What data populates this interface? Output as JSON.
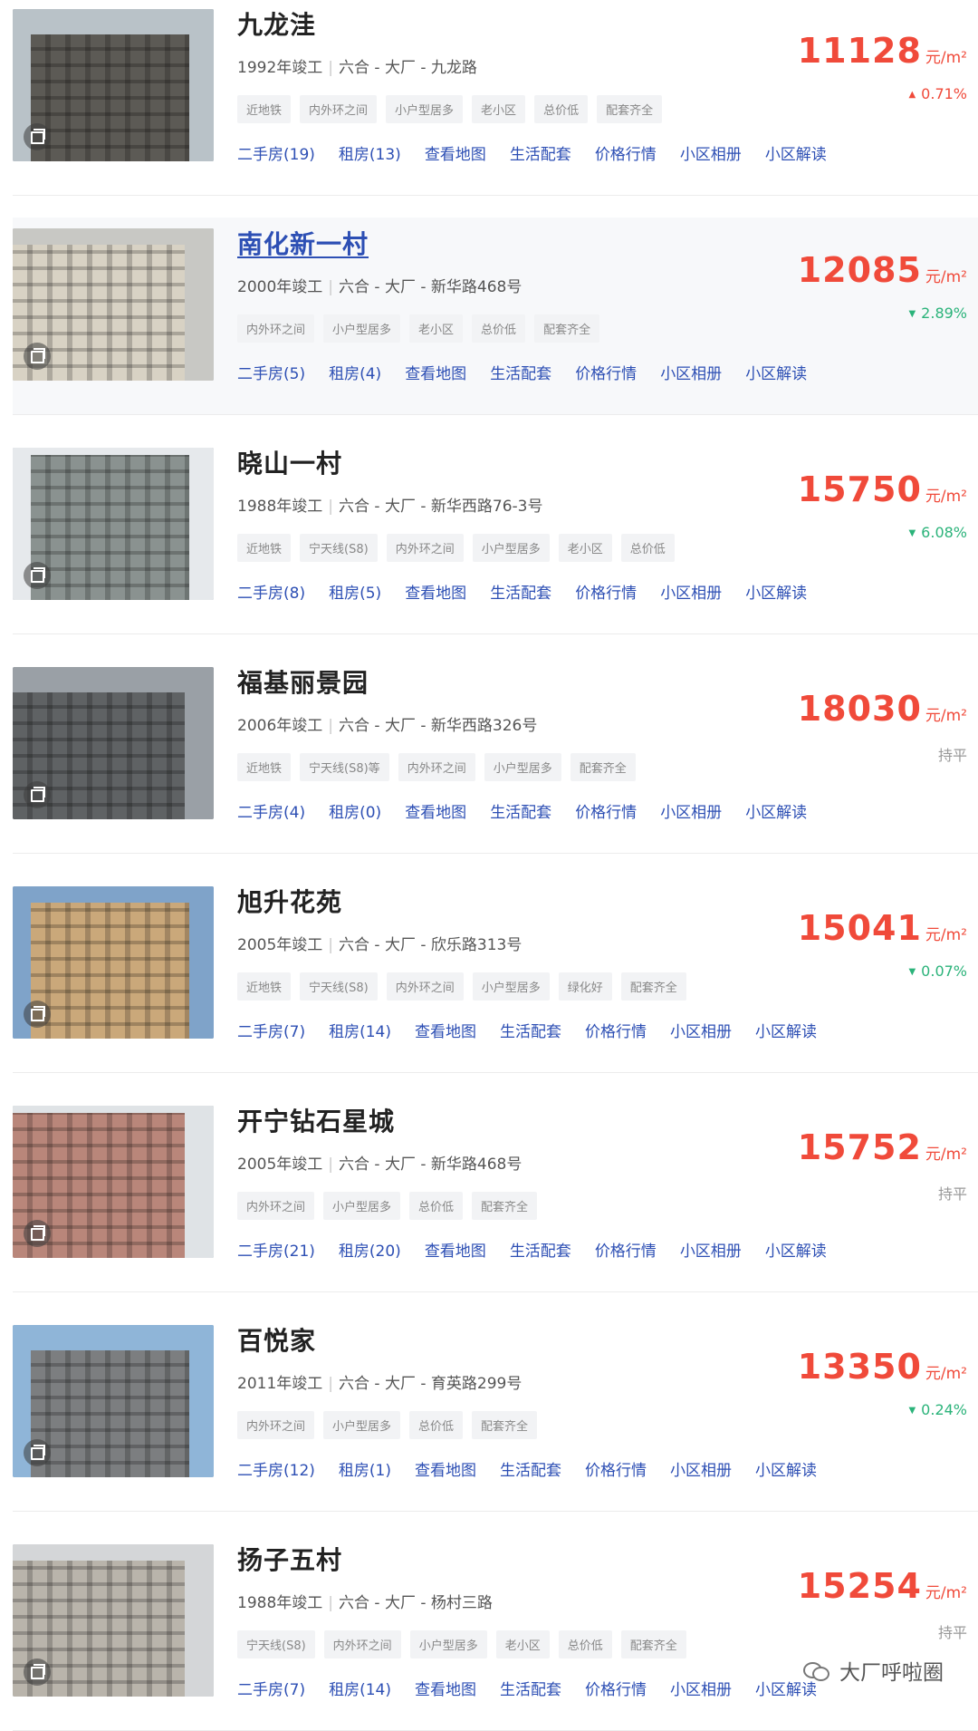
{
  "listings": [
    {
      "name": "九龙洼",
      "year": "1992年竣工",
      "region": "六合 - 大厂 - 九龙路",
      "tags": [
        "近地铁",
        "内外环之间",
        "小户型居多",
        "老小区",
        "总价低",
        "配套齐全"
      ],
      "links": [
        "二手房(19)",
        "租房(13)",
        "查看地图",
        "生活配套",
        "价格行情",
        "小区相册",
        "小区解读"
      ],
      "price": "11128",
      "unit": "元/m²",
      "change": "0.71%",
      "trend": "up"
    },
    {
      "name": "南化新一村",
      "year": "2000年竣工",
      "region": "六合 - 大厂 - 新华路468号",
      "tags": [
        "内外环之间",
        "小户型居多",
        "老小区",
        "总价低",
        "配套齐全"
      ],
      "links": [
        "二手房(5)",
        "租房(4)",
        "查看地图",
        "生活配套",
        "价格行情",
        "小区相册",
        "小区解读"
      ],
      "price": "12085",
      "unit": "元/m²",
      "change": "2.89%",
      "trend": "down"
    },
    {
      "name": "晓山一村",
      "year": "1988年竣工",
      "region": "六合 - 大厂 - 新华西路76-3号",
      "tags": [
        "近地铁",
        "宁天线(S8)",
        "内外环之间",
        "小户型居多",
        "老小区",
        "总价低"
      ],
      "links": [
        "二手房(8)",
        "租房(5)",
        "查看地图",
        "生活配套",
        "价格行情",
        "小区相册",
        "小区解读"
      ],
      "price": "15750",
      "unit": "元/m²",
      "change": "6.08%",
      "trend": "down"
    },
    {
      "name": "福基丽景园",
      "year": "2006年竣工",
      "region": "六合 - 大厂 - 新华西路326号",
      "tags": [
        "近地铁",
        "宁天线(S8)等",
        "内外环之间",
        "小户型居多",
        "配套齐全"
      ],
      "links": [
        "二手房(4)",
        "租房(0)",
        "查看地图",
        "生活配套",
        "价格行情",
        "小区相册",
        "小区解读"
      ],
      "price": "18030",
      "unit": "元/m²",
      "change": "持平",
      "trend": "flat"
    },
    {
      "name": "旭升花苑",
      "year": "2005年竣工",
      "region": "六合 - 大厂 - 欣乐路313号",
      "tags": [
        "近地铁",
        "宁天线(S8)",
        "内外环之间",
        "小户型居多",
        "绿化好",
        "配套齐全"
      ],
      "links": [
        "二手房(7)",
        "租房(14)",
        "查看地图",
        "生活配套",
        "价格行情",
        "小区相册",
        "小区解读"
      ],
      "price": "15041",
      "unit": "元/m²",
      "change": "0.07%",
      "trend": "down"
    },
    {
      "name": "开宁钻石星城",
      "year": "2005年竣工",
      "region": "六合 - 大厂 - 新华路468号",
      "tags": [
        "内外环之间",
        "小户型居多",
        "总价低",
        "配套齐全"
      ],
      "links": [
        "二手房(21)",
        "租房(20)",
        "查看地图",
        "生活配套",
        "价格行情",
        "小区相册",
        "小区解读"
      ],
      "price": "15752",
      "unit": "元/m²",
      "change": "持平",
      "trend": "flat"
    },
    {
      "name": "百悦家",
      "year": "2011年竣工",
      "region": "六合 - 大厂 - 育英路299号",
      "tags": [
        "内外环之间",
        "小户型居多",
        "总价低",
        "配套齐全"
      ],
      "links": [
        "二手房(12)",
        "租房(1)",
        "查看地图",
        "生活配套",
        "价格行情",
        "小区相册",
        "小区解读"
      ],
      "price": "13350",
      "unit": "元/m²",
      "change": "0.24%",
      "trend": "down"
    },
    {
      "name": "扬子五村",
      "year": "1988年竣工",
      "region": "六合 - 大厂 - 杨村三路",
      "tags": [
        "宁天线(S8)",
        "内外环之间",
        "小户型居多",
        "老小区",
        "总价低",
        "配套齐全"
      ],
      "links": [
        "二手房(7)",
        "租房(14)",
        "查看地图",
        "生活配套",
        "价格行情",
        "小区相册",
        "小区解读"
      ],
      "price": "15254",
      "unit": "元/m²",
      "change": "持平",
      "trend": "flat"
    }
  ],
  "watermark": "大厂呼啦圈",
  "colors": {
    "price": "#f04a3a",
    "up": "#f04a3a",
    "down": "#2bb37a",
    "link": "#2d4fb4"
  }
}
